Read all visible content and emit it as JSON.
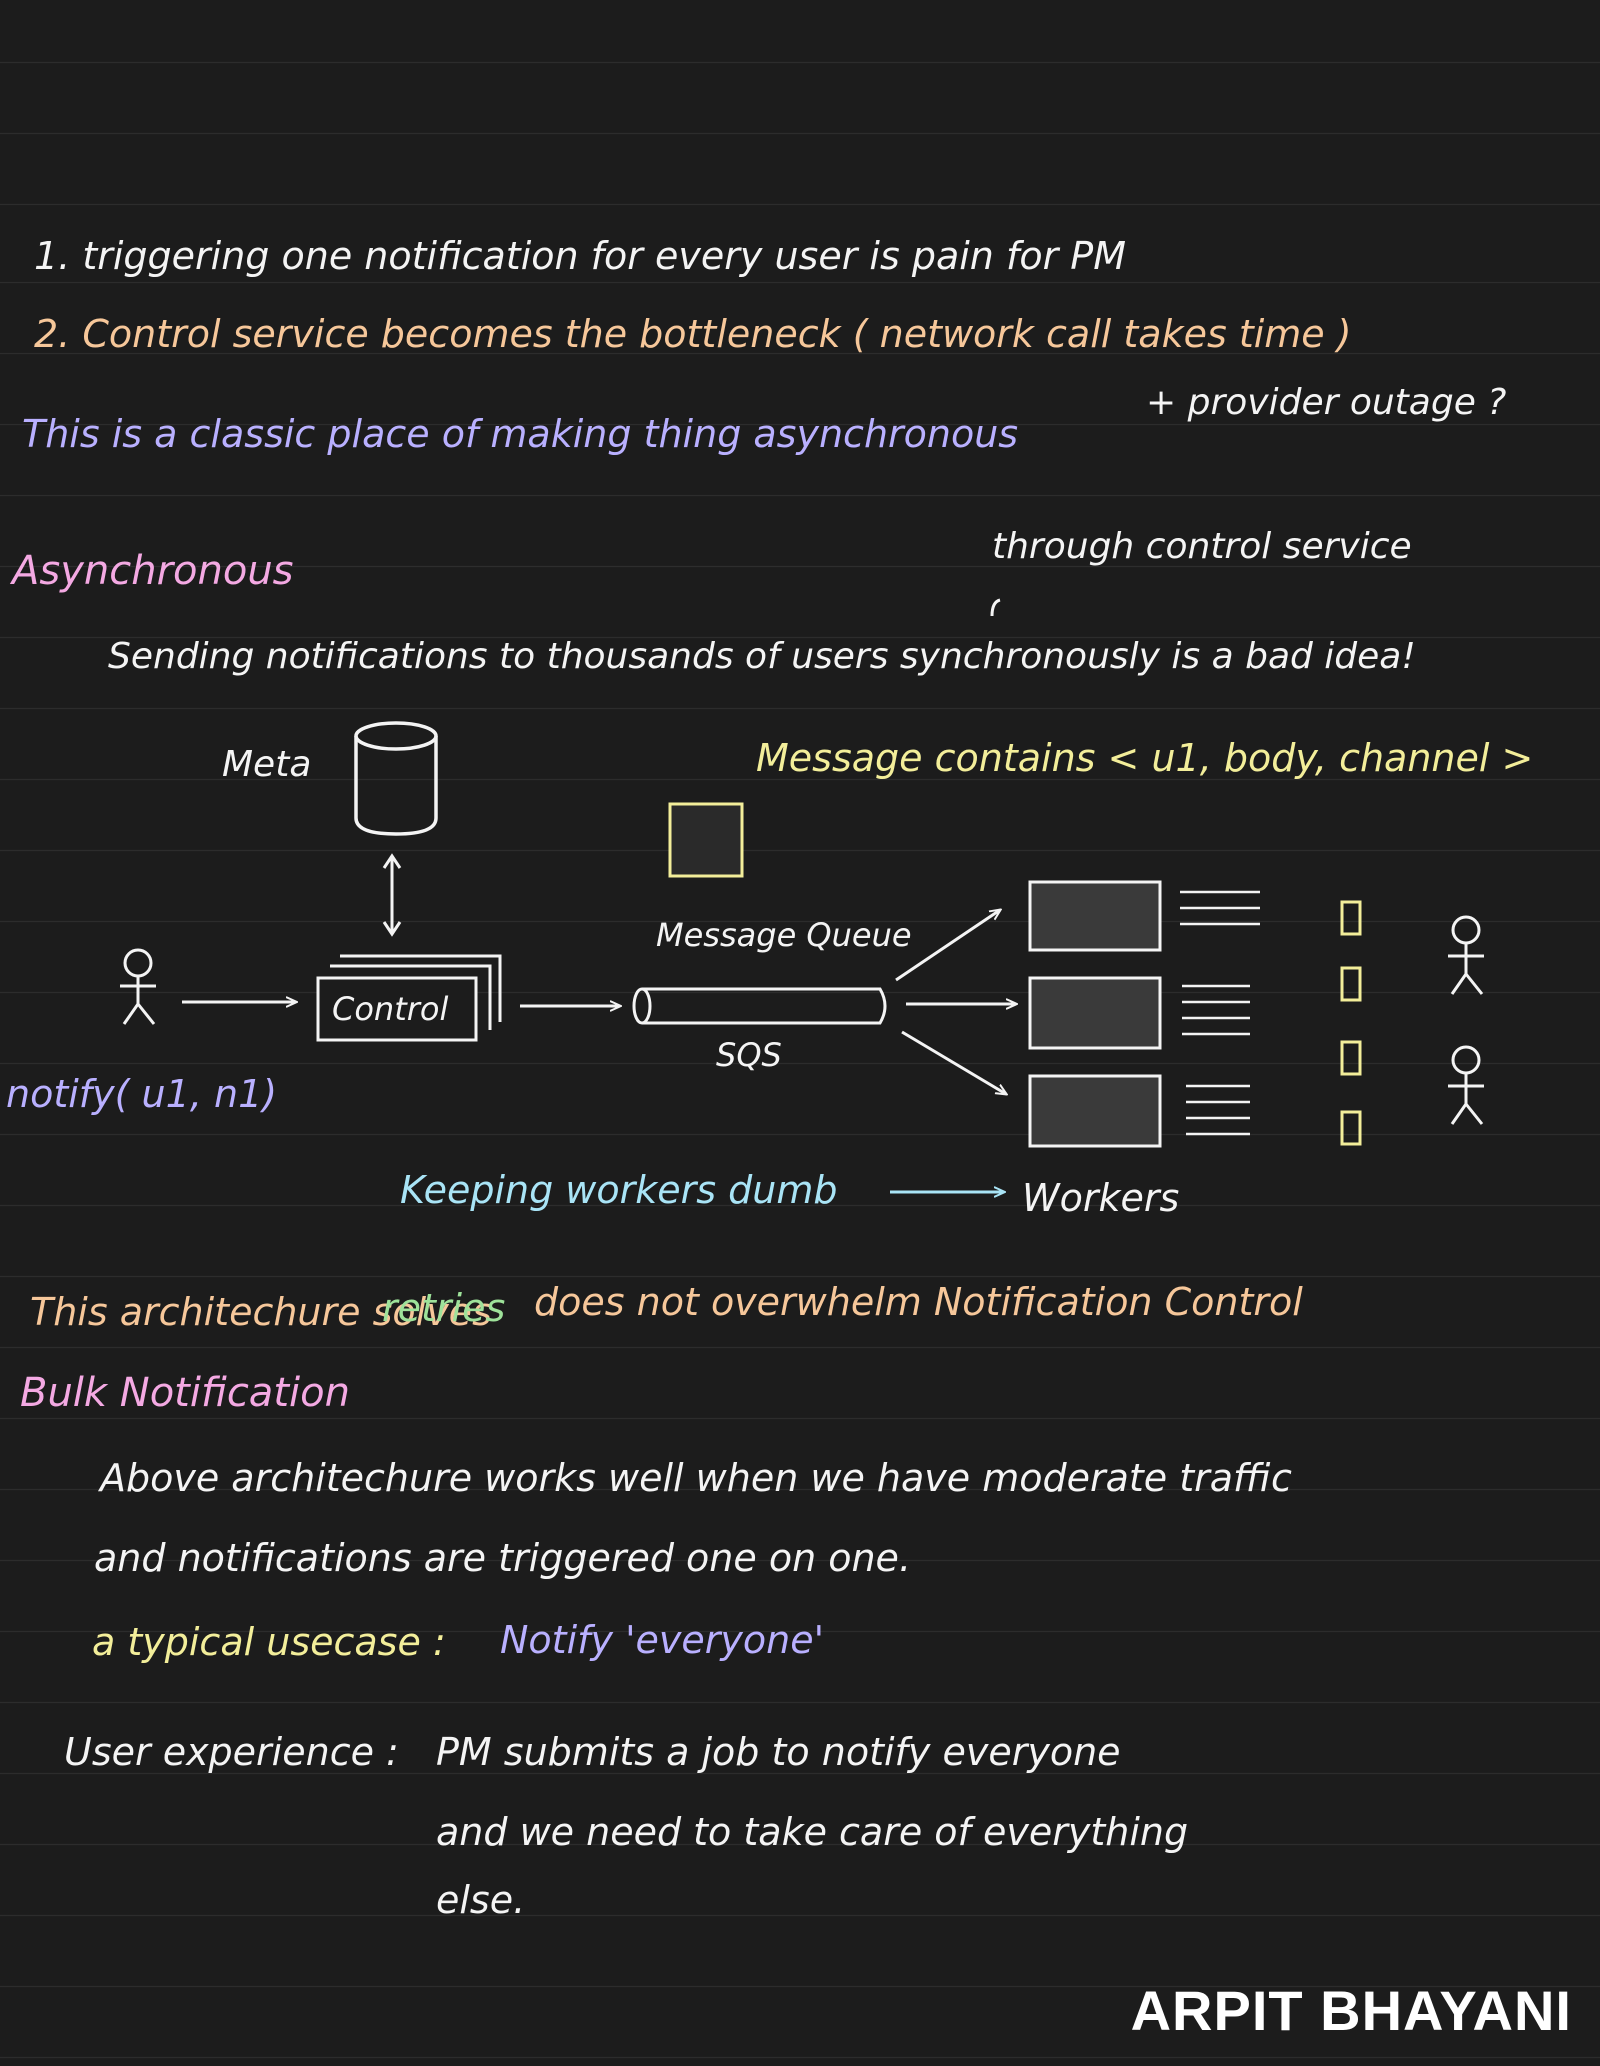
{
  "lines": {
    "item1": "1. triggering one notification for every user is pain for PM",
    "item2": "2. Control service becomes the bottleneck ( network call takes time )",
    "provider_note": "+ provider outage ?",
    "classic_place": "This is a classic place of making thing asynchronous",
    "async_heading": "Asynchronous",
    "through_control": "through control service",
    "sending_note": "Sending notifications to thousands of users synchronously is a bad idea!",
    "message_contains": "Message contains < u1, body, channel >",
    "keeping_workers_dumb": "Keeping workers dumb",
    "workers": "Workers",
    "architecture_solves_a": "This architechure solves",
    "architecture_solves_b": "retries",
    "architecture_solves_c": "does not overwhelm Notification Control",
    "bulk_heading": "Bulk Notification",
    "bulk_1": "Above architechure works well when we have moderate traffic",
    "bulk_2": "and notifications are triggered one on one.",
    "typical_label": "a typical usecase :",
    "typical_value": "Notify 'everyone'",
    "ux_label": "User experience :",
    "ux_1": "PM submits a job to notify everyone",
    "ux_2": "and we need to take care of everything",
    "ux_3": "else."
  },
  "diagram": {
    "meta_label": "Meta",
    "control_label": "Control",
    "queue_label": "Message Queue",
    "sqs_label": "SQS",
    "notify_call": "notify( u1, n1)"
  },
  "brand": "ARPIT BHAYANI",
  "colors": {
    "background": "#1c1c1c",
    "white": "#f4f4f4",
    "orange": "#f6c79a",
    "purple": "#b9b0ff",
    "pink": "#f4a9e3",
    "yellow": "#f3ee9a",
    "cyan": "#a9e4f6",
    "green": "#9ee29a"
  }
}
